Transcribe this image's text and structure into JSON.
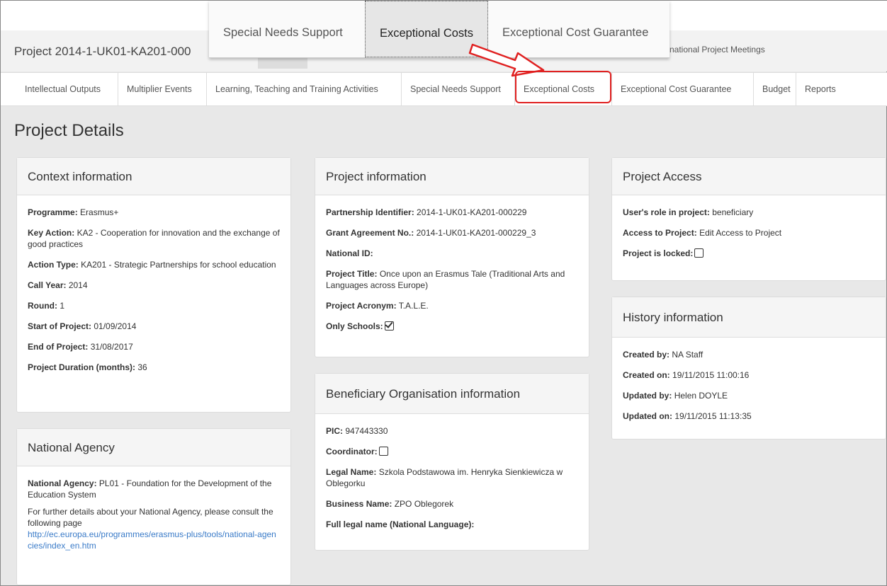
{
  "header": {
    "project_title": "Project 2014-1-UK01-KA201-000",
    "behind_text": "national Project Meetings"
  },
  "popup_tabs": [
    {
      "label": "Special Needs Support"
    },
    {
      "label": "Exceptional Costs"
    },
    {
      "label": "Exceptional Cost Guarantee"
    }
  ],
  "nav_tabs": [
    {
      "label": "Intellectual Outputs"
    },
    {
      "label": "Multiplier Events"
    },
    {
      "label": "Learning, Teaching and Training Activities"
    },
    {
      "label": "Special Needs Support"
    },
    {
      "label": "Exceptional Costs"
    },
    {
      "label": "Exceptional Cost Guarantee"
    },
    {
      "label": "Budget"
    },
    {
      "label": "Reports"
    }
  ],
  "page_title": "Project Details",
  "context": {
    "title": "Context information",
    "rows": [
      {
        "label": "Programme:",
        "value": "Erasmus+"
      },
      {
        "label": "Key Action:",
        "value": "KA2 - Cooperation for innovation and the exchange of good practices"
      },
      {
        "label": "Action Type:",
        "value": "KA201 - Strategic Partnerships for school education"
      },
      {
        "label": "Call Year:",
        "value": "2014"
      },
      {
        "label": "Round:",
        "value": "1"
      },
      {
        "label": "Start of Project:",
        "value": "01/09/2014"
      },
      {
        "label": "End of Project:",
        "value": "31/08/2017"
      },
      {
        "label": "Project Duration (months):",
        "value": "36"
      }
    ]
  },
  "national_agency": {
    "title": "National Agency",
    "label": "National Agency:",
    "value": "PL01 - Foundation for the Development of the Education System",
    "text": "For further details about your National Agency, please consult the following page",
    "link": "http://ec.europa.eu/programmes/erasmus-plus/tools/national-agencies/index_en.htm"
  },
  "project_info": {
    "title": "Project information",
    "rows": [
      {
        "label": "Partnership Identifier:",
        "value": "2014-1-UK01-KA201-000229"
      },
      {
        "label": "Grant Agreement No.:",
        "value": "2014-1-UK01-KA201-000229_3"
      },
      {
        "label": "National ID:",
        "value": ""
      },
      {
        "label": "Project Title:",
        "value": "Once upon an Erasmus Tale (Traditional Arts and Languages across Europe)"
      },
      {
        "label": "Project Acronym:",
        "value": "T.A.L.E."
      }
    ],
    "only_schools_label": "Only Schools:",
    "only_schools_checked": true
  },
  "beneficiary": {
    "title": "Beneficiary Organisation information",
    "pic_label": "PIC:",
    "pic_value": "947443330",
    "coordinator_label": "Coordinator:",
    "coordinator_checked": false,
    "legal_name_label": "Legal Name:",
    "legal_name_value": "Szkola Podstawowa im. Henryka Sienkiewicza w Oblegorku",
    "business_name_label": "Business Name:",
    "business_name_value": "ZPO Oblegorek",
    "full_legal_label": "Full legal name (National Language):"
  },
  "access": {
    "title": "Project Access",
    "role_label": "User's role in project:",
    "role_value": "beneficiary",
    "access_label": "Access to Project:",
    "access_value": "Edit Access to Project",
    "locked_label": "Project is locked:",
    "locked_checked": false
  },
  "history": {
    "title": "History information",
    "rows": [
      {
        "label": "Created by:",
        "value": "NA Staff"
      },
      {
        "label": "Created on:",
        "value": "19/11/2015 11:00:16"
      },
      {
        "label": "Updated by:",
        "value": "Helen DOYLE"
      },
      {
        "label": "Updated on:",
        "value": "19/11/2015 11:13:35"
      }
    ]
  },
  "colors": {
    "highlight": "#e02020",
    "link": "#3a7bc8"
  }
}
